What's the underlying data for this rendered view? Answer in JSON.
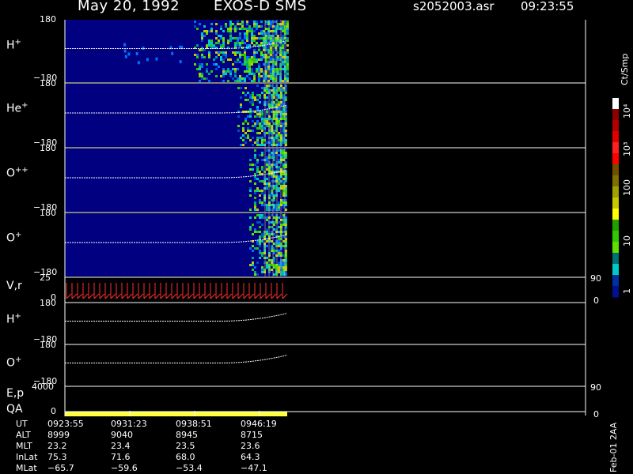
{
  "header": {
    "date": "May 20, 1992",
    "instrument": "EXOS-D SMS",
    "file": "s2052003.asr",
    "time": "09:23:55"
  },
  "panels": [
    {
      "label": "H",
      "sup": "+",
      "ytop": "180",
      "ybot": "−180"
    },
    {
      "label": "He",
      "sup": "+",
      "ytop": "180",
      "ybot": "−180"
    },
    {
      "label": "O",
      "sup": "++",
      "ytop": "180",
      "ybot": "−180"
    },
    {
      "label": "O",
      "sup": "+",
      "ytop": "180",
      "ybot": "−180"
    },
    {
      "label": "V,r",
      "sup": "",
      "ytop": "25",
      "ybot": "0",
      "rtop": "90",
      "rbot": "0"
    },
    {
      "label": "H",
      "sup": "+",
      "ytop": "180",
      "ybot": "−180"
    },
    {
      "label": "O",
      "sup": "+",
      "ytop": "180",
      "ybot": "−180"
    },
    {
      "label": "E,p",
      "sup": "",
      "ytop": "4000",
      "ybot": "",
      "rtop": "90",
      "rbot": ""
    },
    {
      "label": "QA",
      "sup": "",
      "ytop": "",
      "ybot": "0",
      "rtop": "",
      "rbot": "0"
    }
  ],
  "colorbar": {
    "title": "Ct/Smp",
    "ticks": [
      "10⁴",
      "10³",
      "100",
      "10",
      "1"
    ],
    "colors": [
      "#ffffff",
      "#8b0000",
      "#b00000",
      "#e00000",
      "#ff2020",
      "#ff0000",
      "#705000",
      "#807000",
      "#a0a000",
      "#c8c800",
      "#ffff00",
      "#20a000",
      "#30c800",
      "#60e000",
      "#007070",
      "#00c8c8",
      "#0030a0",
      "#001090"
    ]
  },
  "ephemeris": {
    "rows": [
      {
        "label": "UT",
        "values": [
          "0923:55",
          "0931:23",
          "0938:51",
          "0946:19"
        ]
      },
      {
        "label": "ALT",
        "values": [
          "8999",
          "9040",
          "8945",
          "8715"
        ]
      },
      {
        "label": "MLT",
        "values": [
          "23.2",
          "23.4",
          "23.5",
          "23.6"
        ]
      },
      {
        "label": "InLat",
        "values": [
          "75.3",
          "71.6",
          "68.0",
          "64.3"
        ]
      },
      {
        "label": "MLat",
        "values": [
          "−65.7",
          "−59.6",
          "−53.4",
          "−47.1"
        ]
      }
    ]
  },
  "footer": {
    "stamp": "Feb-01 2AA"
  },
  "chart_data": {
    "type": "heatmap",
    "x_ticks": [
      "0923:55",
      "0931:23",
      "0938:51",
      "0946:19"
    ],
    "colors": {
      "background_fill": "#000080",
      "line": "#ffffff",
      "velocity": "#ff3030",
      "qa": "#ffff40"
    }
  }
}
